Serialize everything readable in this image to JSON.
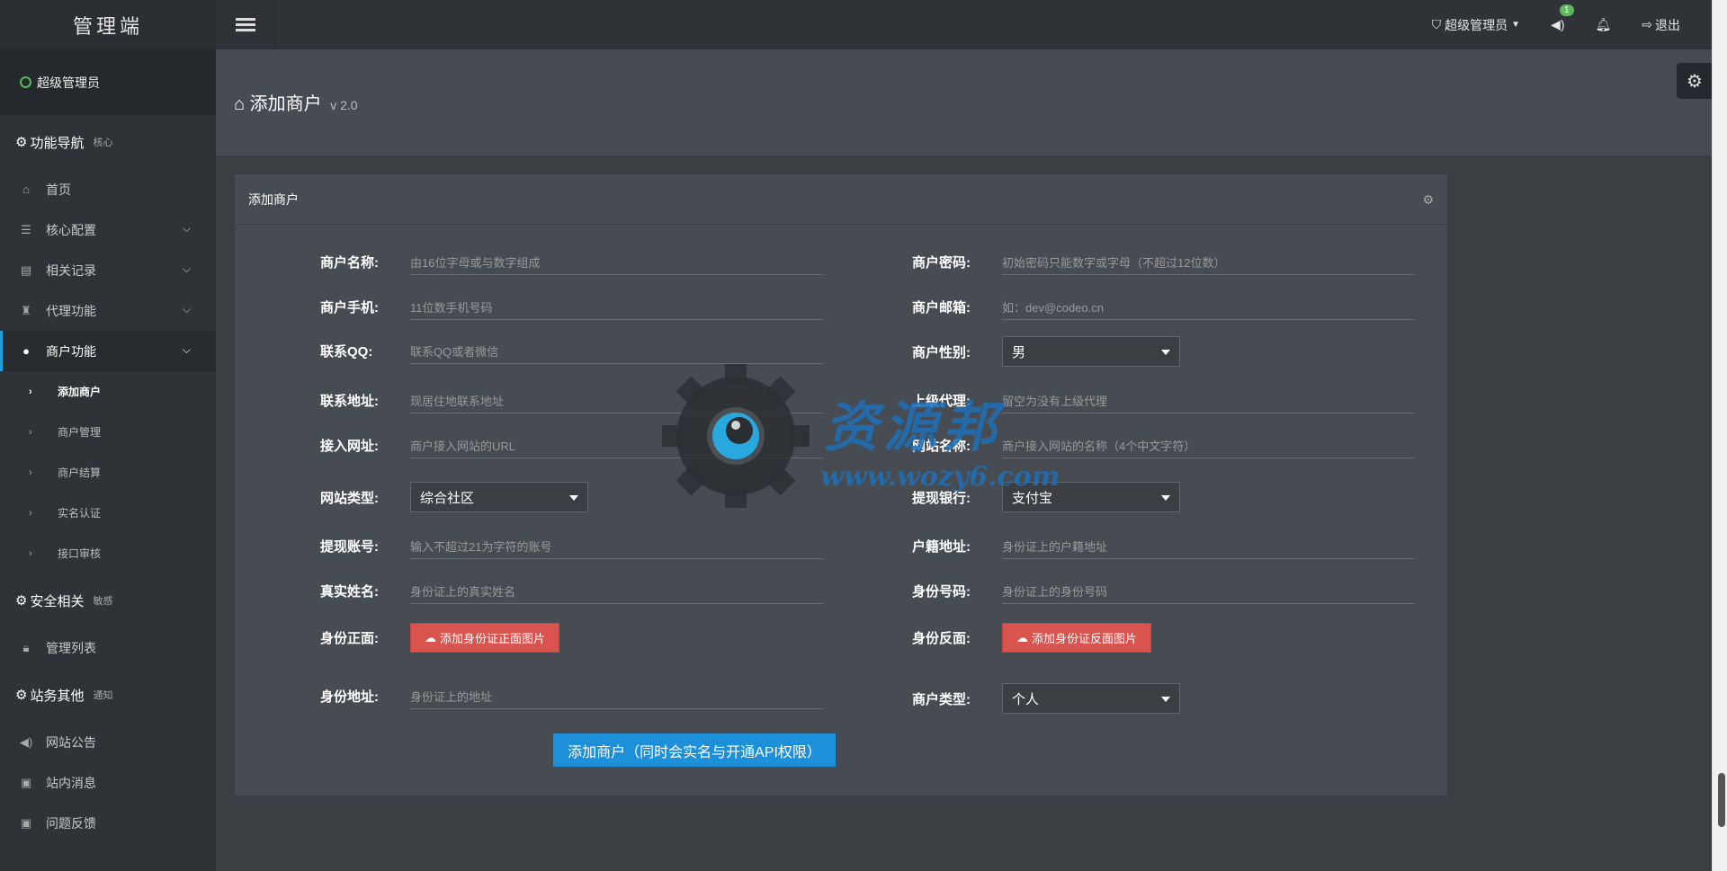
{
  "brand": "管理端",
  "user": {
    "role": "超级管理员"
  },
  "sidebar": {
    "sections": [
      {
        "title": "功能导航",
        "sub": "核心"
      },
      {
        "title": "安全相关",
        "sub": "敏感"
      },
      {
        "title": "站务其他",
        "sub": "通知"
      }
    ],
    "nav": [
      {
        "label": "首页",
        "icon": "home-icon"
      },
      {
        "label": "核心配置",
        "icon": "sliders-icon"
      },
      {
        "label": "相关记录",
        "icon": "record-icon"
      },
      {
        "label": "代理功能",
        "icon": "agent-icon"
      },
      {
        "label": "商户功能",
        "icon": "user-icon"
      }
    ],
    "merchant_sub": [
      "添加商户",
      "商户管理",
      "商户结算",
      "实名认证",
      "接口审核"
    ],
    "security_nav": [
      {
        "label": "管理列表",
        "icon": "lock-icon"
      }
    ],
    "other_nav": [
      {
        "label": "网站公告",
        "icon": "volume-icon"
      },
      {
        "label": "站内消息",
        "icon": "inbox-icon"
      },
      {
        "label": "问题反馈",
        "icon": "feedback-icon"
      }
    ]
  },
  "topbar": {
    "admin_label": "超级管理员",
    "notice_count": "1",
    "logout_label": "退出"
  },
  "page": {
    "title": "添加商户",
    "version": "v 2.0"
  },
  "panel": {
    "title": "添加商户",
    "fields": {
      "merchant_name": {
        "label": "商户名称:",
        "placeholder": "由16位字母或与数字组成"
      },
      "merchant_password": {
        "label": "商户密码:",
        "placeholder": "初始密码只能数字或字母（不超过12位数）"
      },
      "merchant_phone": {
        "label": "商户手机:",
        "placeholder": "11位数手机号码"
      },
      "merchant_email": {
        "label": "商户邮箱:",
        "placeholder": "如：dev@codeo.cn"
      },
      "contact_qq": {
        "label": "联系QQ:",
        "placeholder": "联系QQ或者微信"
      },
      "merchant_gender": {
        "label": "商户性别:",
        "value": "男"
      },
      "contact_address": {
        "label": "联系地址:",
        "placeholder": "现居住地联系地址"
      },
      "parent_agent": {
        "label": "上级代理:",
        "placeholder": "留空为没有上级代理"
      },
      "access_url": {
        "label": "接入网址:",
        "placeholder": "商户接入网站的URL"
      },
      "site_name": {
        "label": "网站名称:",
        "placeholder": "商户接入网站的名称（4个中文字符）"
      },
      "site_type": {
        "label": "网站类型:",
        "value": "综合社区"
      },
      "withdraw_bank": {
        "label": "提现银行:",
        "value": "支付宝"
      },
      "withdraw_account": {
        "label": "提现账号:",
        "placeholder": "输入不超过21为字符的账号"
      },
      "household_address": {
        "label": "户籍地址:",
        "placeholder": "身份证上的户籍地址"
      },
      "real_name": {
        "label": "真实姓名:",
        "placeholder": "身份证上的真实姓名"
      },
      "id_number": {
        "label": "身份号码:",
        "placeholder": "身份证上的身份号码"
      },
      "id_front": {
        "label": "身份正面:",
        "button": "添加身份证正面图片"
      },
      "id_back": {
        "label": "身份反面:",
        "button": "添加身份证反面图片"
      },
      "id_address": {
        "label": "身份地址:",
        "placeholder": "身份证上的地址"
      },
      "merchant_type": {
        "label": "商户类型:",
        "value": "个人"
      }
    },
    "submit_label": "添加商户（同时会实名与开通API权限）"
  },
  "watermark": {
    "text": "资源邦",
    "url": "www.wozy6.com"
  },
  "colors": {
    "accent": "#1e8fd9",
    "danger": "#d9534f",
    "success": "#5cb85c",
    "sidebar": "#2f3338",
    "panel": "#474c52"
  }
}
